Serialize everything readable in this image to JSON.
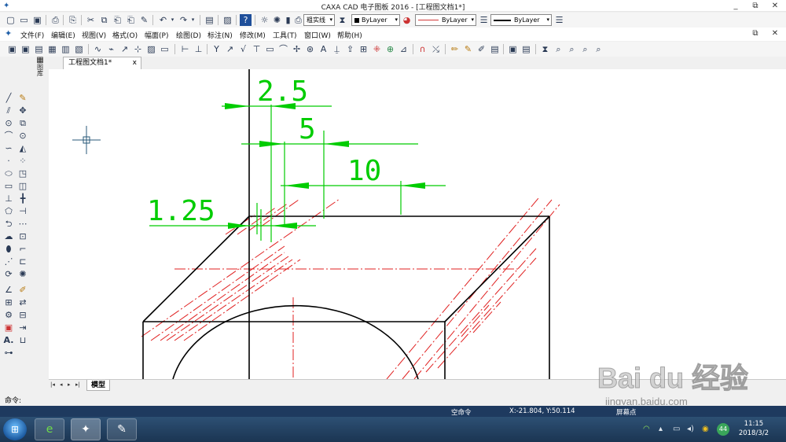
{
  "window": {
    "title": "CAXA CAD 电子图板 2016 - [工程图文档1*]",
    "minimize": "_",
    "restore": "⧉",
    "close": "✕"
  },
  "toolbar": {
    "layer_combo": "粗实线",
    "color_combo": "ByLayer",
    "linetype_combo": "ByLayer",
    "lineweight_combo": "ByLayer"
  },
  "menu": {
    "items": [
      "文件(F)",
      "编辑(E)",
      "视图(V)",
      "格式(O)",
      "幅面(P)",
      "绘图(D)",
      "标注(N)",
      "修改(M)",
      "工具(T)",
      "窗口(W)",
      "帮助(H)"
    ]
  },
  "tabs": {
    "doc_tab": "工程图文档1*",
    "doc_tab_close": "x"
  },
  "side_label": "图库",
  "drawing": {
    "dim_labels": [
      "2.5",
      "5",
      "10",
      "1.25"
    ]
  },
  "model_tab": {
    "label": "模型",
    "nav": [
      "|◂",
      "◂",
      "▸",
      "▸|"
    ]
  },
  "command": {
    "label": "命令:"
  },
  "status": {
    "mode": "空命令",
    "coords": "X:-21.804, Y:50.114",
    "snap": "屏幕点"
  },
  "taskbar": {
    "clock_time": "11:15",
    "clock_date": "2018/3/2",
    "tray_badge": "44"
  },
  "watermark": {
    "brand": "Bai du 经验",
    "url": "jingyan.baidu.com"
  },
  "colors": {
    "accent_green": "#00cc00",
    "center_red": "#e02020",
    "statusbar": "#1e3a5f"
  }
}
